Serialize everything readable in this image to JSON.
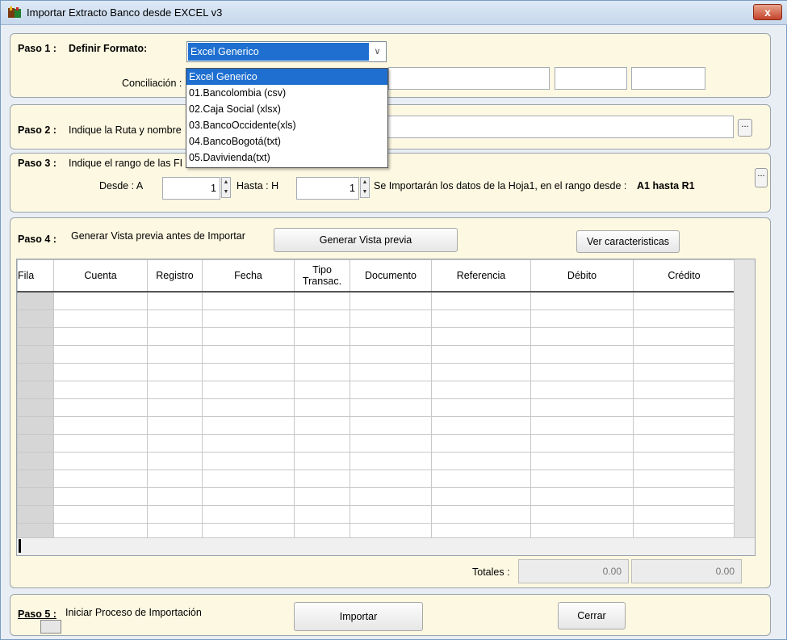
{
  "window": {
    "title": "Importar Extracto Banco desde EXCEL v3",
    "close_label": "x"
  },
  "paso1": {
    "label": "Paso 1 :",
    "format_label": "Definir Formato:",
    "format_selected": "Excel Generico",
    "format_options": [
      "Excel Generico",
      "01.Bancolombia (csv)",
      "02.Caja Social (xlsx)",
      "03.BancoOccidente(xls)",
      "04.BancoBogotá(txt)",
      "05.Davivienda(txt)"
    ],
    "conciliacion_label": "Conciliación :"
  },
  "paso2": {
    "label": "Paso 2 :",
    "text": "Indique la Ruta y nombre",
    "browse_label": "..."
  },
  "paso3": {
    "label": "Paso 3 :",
    "text": "Indique el rango de las FI",
    "desde_label": "Desde  :  A",
    "desde_value": "1",
    "hasta_label": "Hasta  :  H",
    "hasta_value": "1",
    "info_text": "Se Importarán los datos de la Hoja1,  en el rango desde :",
    "info_range": "A1 hasta R1",
    "browse_label": "..."
  },
  "paso4": {
    "label": "Paso 4 :",
    "text": "Generar Vista previa antes de Importar",
    "preview_button": "Generar Vista previa",
    "features_button": "Ver caracteristicas",
    "columns": [
      "Fila",
      "Cuenta",
      "Registro",
      "Fecha",
      "Tipo Transac.",
      "Documento",
      "Referencia",
      "Débito",
      "Crédito"
    ],
    "totales_label": "Totales :",
    "total_debito": "0.00",
    "total_credito": "0.00"
  },
  "paso5": {
    "label": "Paso 5 :",
    "text": "Iniciar Proceso de Importación",
    "import_button": "Importar",
    "close_button": "Cerrar"
  }
}
